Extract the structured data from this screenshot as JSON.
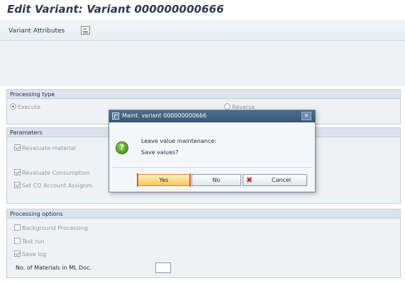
{
  "header": {
    "title": "Edit Variant: Variant 000000000666"
  },
  "toolbar": {
    "variant_attributes_label": "Variant Attributes",
    "icon": "variant-attributes-icon"
  },
  "processing_type": {
    "title": "Processing type",
    "options": [
      {
        "label": "Execute",
        "selected": true
      },
      {
        "label": "Reverse",
        "selected": false
      }
    ]
  },
  "parameters": {
    "title": "Parameters",
    "items": [
      {
        "label": "Revaluate material",
        "checked": true
      },
      {
        "label": "Revaluate Consumption",
        "checked": true
      },
      {
        "label": "Set CO Account Assignm",
        "checked": true
      }
    ]
  },
  "processing_options": {
    "title": "Processing options",
    "items": [
      {
        "label": "Background Processing",
        "checked": false
      },
      {
        "label": "Test run",
        "checked": false
      },
      {
        "label": "Save log",
        "checked": true
      }
    ],
    "no_materials_label": "No. of Materials in ML Doc.",
    "no_materials_value": ""
  },
  "dialog": {
    "title": "Maint. variant 000000000666",
    "close_icon": "close-icon",
    "message_line1": "Leave value maintenance:",
    "message_line2": "Save values?",
    "question_icon": "question-icon",
    "question_glyph": "?",
    "yes_label": "Yes",
    "no_label": "No",
    "cancel_label": "Cancel"
  },
  "colors": {
    "title_bar": "#3a5677",
    "yes_button": "#f5c75a",
    "cancel_icon": "#d01c1c",
    "question_icon": "#3f8a12"
  }
}
